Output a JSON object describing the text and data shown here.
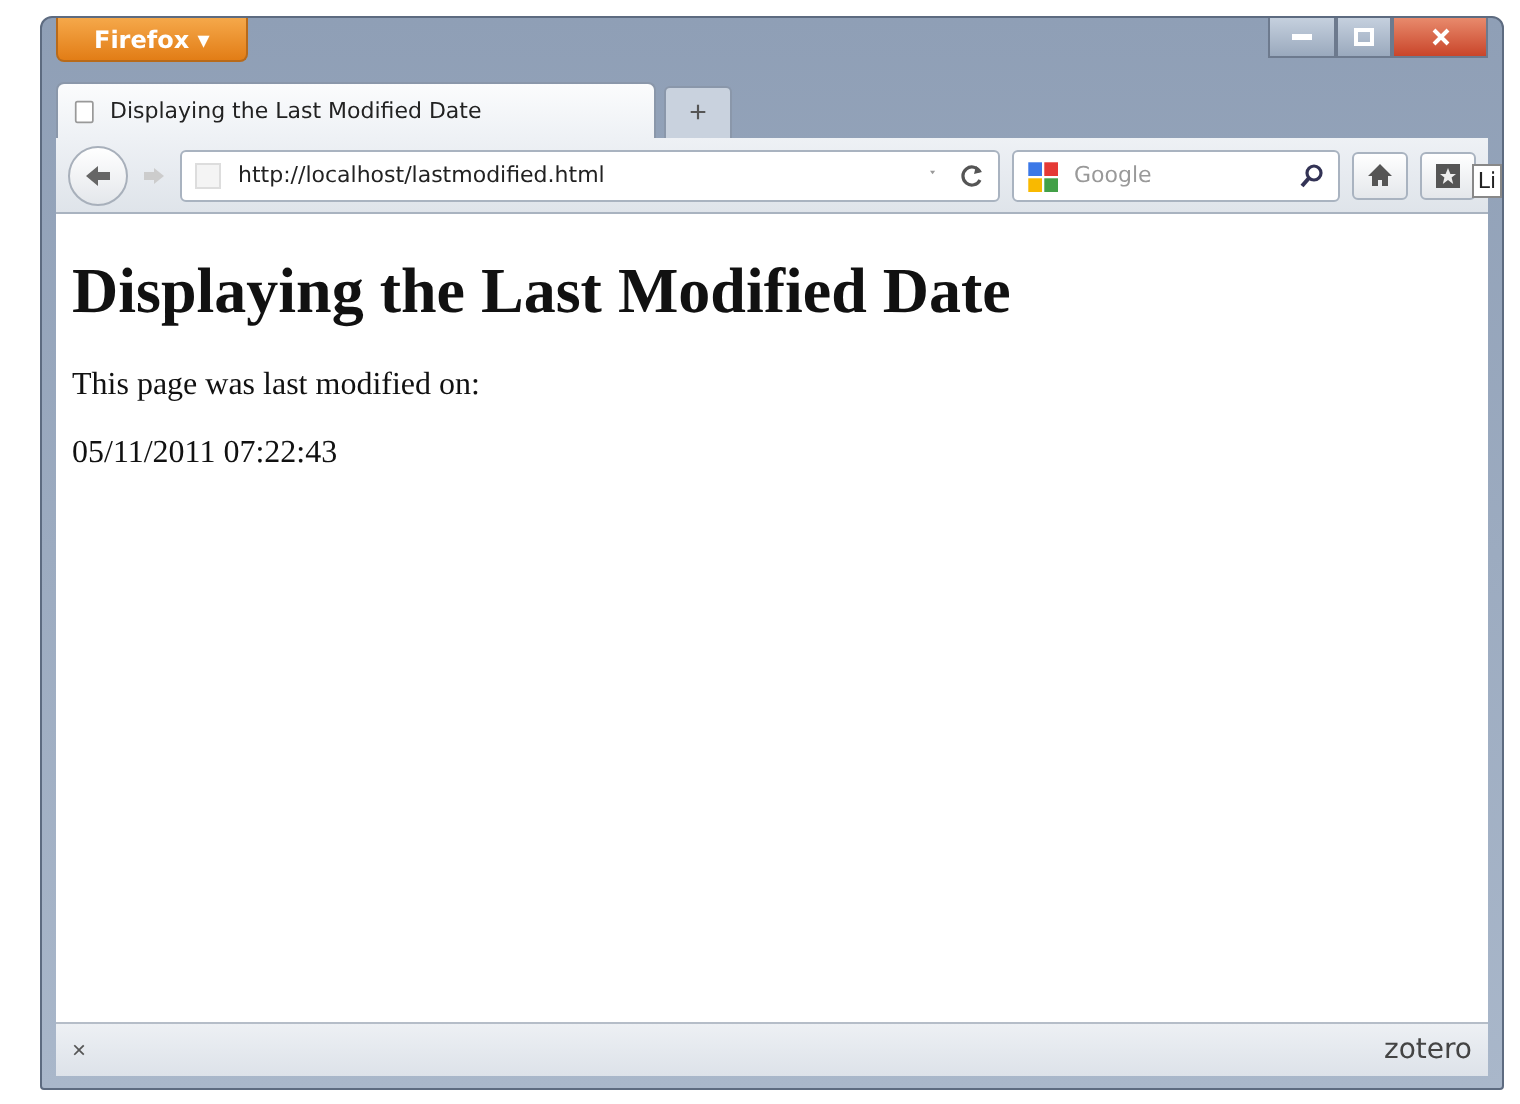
{
  "app_menu": {
    "label": "Firefox ▾"
  },
  "tabs": [
    {
      "title": "Displaying the Last Modified Date",
      "selected": true
    }
  ],
  "new_tab": "+",
  "address_bar": {
    "value": "http://localhost/lastmodified.html"
  },
  "search_bar": {
    "placeholder": "Google"
  },
  "tooltip": "Li",
  "page": {
    "heading": "Displaying the Last Modified Date",
    "paragraphs": [
      "This page was last modified on:",
      "05/11/2011 07:22:43"
    ]
  },
  "status_bar": {
    "close": "×",
    "addon": "zotero"
  }
}
